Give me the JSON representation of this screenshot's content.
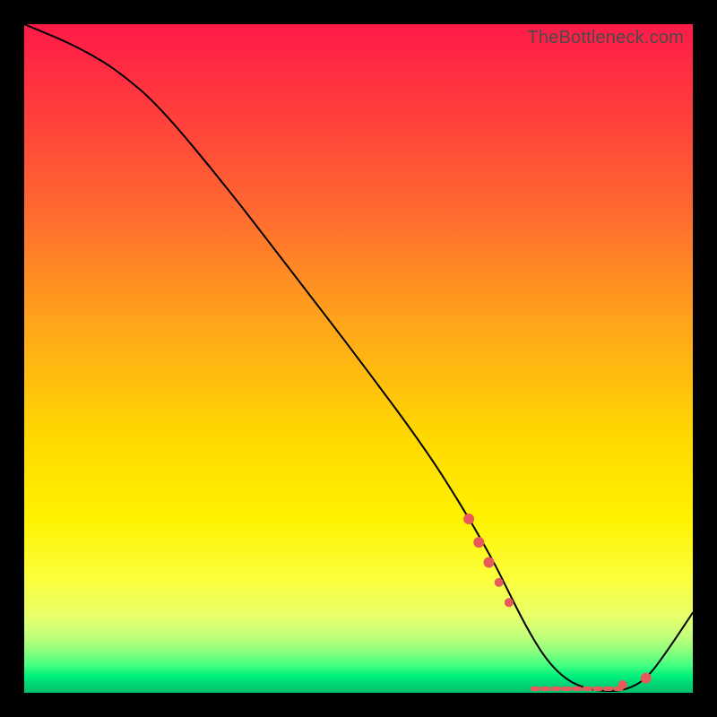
{
  "watermark": "TheBottleneck.com",
  "colors": {
    "frame": "#000000",
    "curve": "#000000",
    "marker": "#e85a5a",
    "gradient_stops": [
      "#ff1a49",
      "#ff3a3d",
      "#ff6a30",
      "#ffa61a",
      "#ffd900",
      "#fff200",
      "#fbff3d",
      "#e8ff6a",
      "#c3ff7a",
      "#86ff7d",
      "#3fff82",
      "#00f07c",
      "#00d676",
      "#00c06e"
    ]
  },
  "chart_data": {
    "type": "line",
    "title": "",
    "xlabel": "",
    "ylabel": "",
    "xlim": [
      0,
      100
    ],
    "ylim": [
      0,
      100
    ],
    "grid": false,
    "series": [
      {
        "name": "bottleneck-curve",
        "x": [
          0,
          6,
          10,
          14,
          20,
          30,
          40,
          50,
          60,
          66,
          70,
          72,
          75,
          78,
          81,
          84,
          87,
          90,
          93,
          96,
          100
        ],
        "y": [
          100,
          97.5,
          95.5,
          93,
          88,
          76,
          63,
          50,
          36.5,
          27,
          20,
          16,
          10,
          5,
          2,
          0.6,
          0.2,
          0.4,
          2,
          6,
          12
        ]
      }
    ],
    "markers": {
      "name": "highlighted-points",
      "points": [
        {
          "x": 66.5,
          "y": 26.0,
          "r": 6
        },
        {
          "x": 68.0,
          "y": 22.5,
          "r": 6
        },
        {
          "x": 69.5,
          "y": 19.5,
          "r": 6
        },
        {
          "x": 71.0,
          "y": 16.5,
          "r": 5
        },
        {
          "x": 72.5,
          "y": 13.5,
          "r": 5
        },
        {
          "x": 89.5,
          "y": 1.2,
          "r": 5
        },
        {
          "x": 93.0,
          "y": 2.2,
          "r": 6
        }
      ]
    },
    "threshold_band": {
      "name": "dashed-threshold",
      "y": 0.6,
      "x_start": 76,
      "x_end": 90,
      "segments": 9
    }
  }
}
